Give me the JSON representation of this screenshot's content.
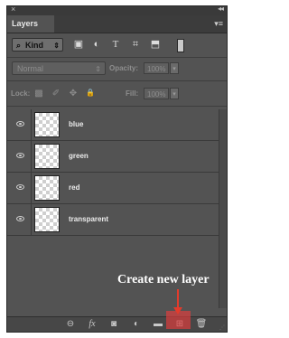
{
  "panel": {
    "close_glyph": "×",
    "collapse_glyph": "◂◂",
    "tab_label": "Layers",
    "menu_glyph": "▾≡"
  },
  "filter": {
    "kind_label": "Kind",
    "kind_arrow": "⇕",
    "search_glyph": "⌕",
    "icons": [
      "pixel-filter-icon",
      "adjustment-filter-icon",
      "type-filter-icon",
      "shape-filter-icon",
      "smart-object-filter-icon"
    ],
    "glyphs": [
      "▣",
      "◐",
      "T",
      "⌗",
      "⬒"
    ]
  },
  "blend": {
    "mode": "Normal",
    "arrow": "⇕",
    "opacity_label": "Opacity:",
    "opacity_value": "100%",
    "lock_label": "Lock:",
    "fill_label": "Fill:",
    "fill_value": "100%",
    "stepper_glyph": "▾",
    "lock_glyphs": [
      "▩",
      "✐",
      "✥",
      "🔒"
    ]
  },
  "layers": [
    {
      "name": "blue"
    },
    {
      "name": "green"
    },
    {
      "name": "red"
    },
    {
      "name": "transparent"
    }
  ],
  "bottom": {
    "glyphs": [
      "⊖",
      "fx",
      "◙",
      "◐",
      "▬",
      "⊞",
      "🗑"
    ]
  },
  "callout": {
    "text": "Create new layer",
    "color": "#e23b2c"
  }
}
